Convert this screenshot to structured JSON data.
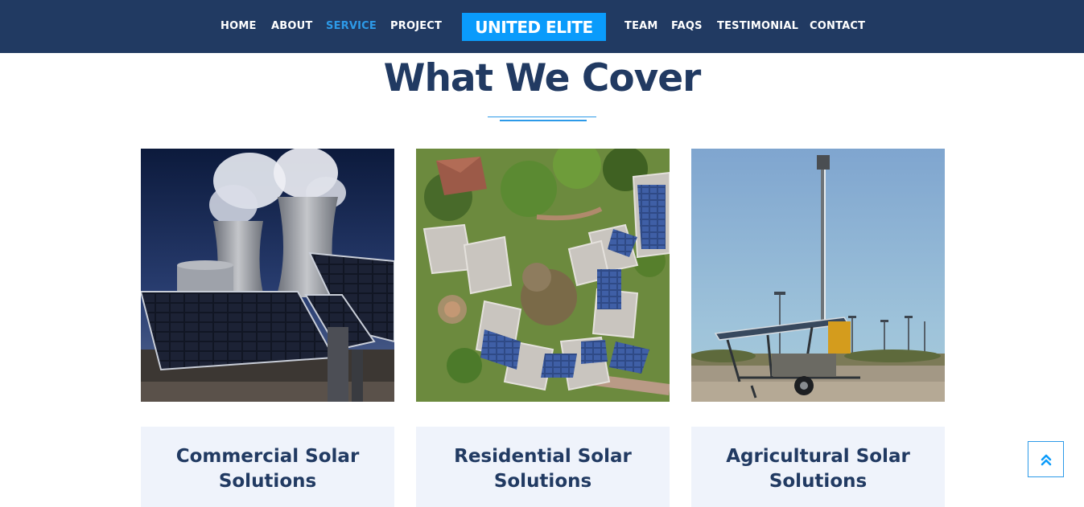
{
  "nav": {
    "items_left": [
      {
        "label": "HOME",
        "active": false
      },
      {
        "label": "ABOUT",
        "active": false
      },
      {
        "label": "SERVICE",
        "active": true
      },
      {
        "label": "PROJECT",
        "active": false
      }
    ],
    "brand": "UNITED ELITE",
    "items_right": [
      {
        "label": "TEAM",
        "active": false
      },
      {
        "label": "FAQS",
        "active": false
      },
      {
        "label": "TESTIMONIAL",
        "active": false
      },
      {
        "label": "CONTACT",
        "active": false
      }
    ]
  },
  "section": {
    "title": "What We Cover"
  },
  "cards": [
    {
      "title": "Commercial Solar Solutions",
      "image": "power-plant-solar-panels-photo"
    },
    {
      "title": "Residential Solar Solutions",
      "image": "aerial-rooftop-solar-homes-photo"
    },
    {
      "title": "Agricultural Solar Solutions",
      "image": "solar-trailer-light-tower-photo"
    }
  ],
  "scroll_top": {
    "icon": "double-chevron-up-icon"
  },
  "colors": {
    "navbar": "#213a62",
    "accent": "#2d9ae8",
    "brand_bg": "#0a9bfb",
    "heading": "#213a62",
    "card_bg": "#eff3fb"
  }
}
